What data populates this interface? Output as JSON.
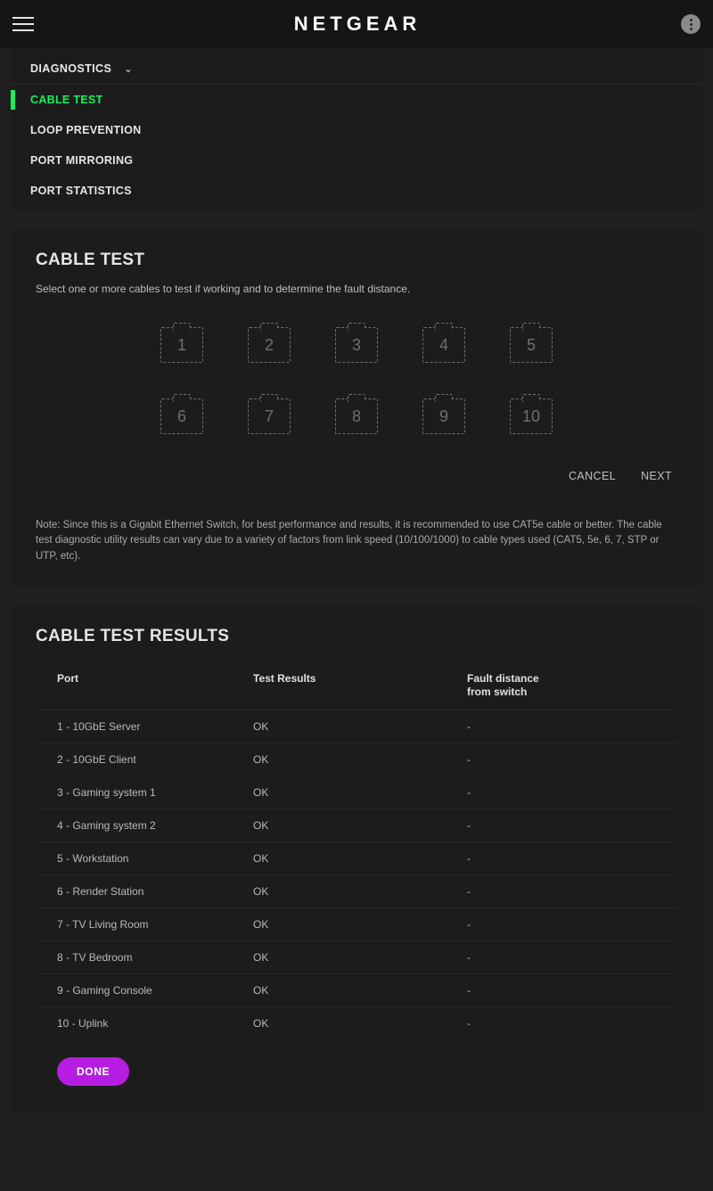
{
  "brand": "NETGEAR",
  "nav": {
    "section": "DIAGNOSTICS",
    "items": [
      {
        "label": "CABLE TEST",
        "active": true
      },
      {
        "label": "LOOP PREVENTION",
        "active": false
      },
      {
        "label": "PORT MIRRORING",
        "active": false
      },
      {
        "label": "PORT STATISTICS",
        "active": false
      }
    ]
  },
  "cable_test": {
    "title": "CABLE TEST",
    "help": "Select one or more cables to test if working and to determine the fault distance.",
    "ports": [
      "1",
      "2",
      "3",
      "4",
      "5",
      "6",
      "7",
      "8",
      "9",
      "10"
    ],
    "cancel": "CANCEL",
    "next": "NEXT",
    "note": "Note: Since this is a Gigabit Ethernet Switch, for best performance and results, it is recommended to use CAT5e cable or better. The cable test diagnostic utility results can vary due to a variety of factors from link speed (10/100/1000) to cable types used (CAT5, 5e, 6, 7, STP or UTP, etc)."
  },
  "results": {
    "title": "CABLE TEST RESULTS",
    "headers": {
      "port": "Port",
      "result": "Test Results",
      "fault": "Fault distance\nfrom switch"
    },
    "rows": [
      {
        "port": "1 - 10GbE Server",
        "result": "OK",
        "fault": "-"
      },
      {
        "port": "2 - 10GbE Client",
        "result": "OK",
        "fault": "-"
      },
      {
        "port": "3 - Gaming system 1",
        "result": "OK",
        "fault": "-"
      },
      {
        "port": "4 - Gaming system 2",
        "result": "OK",
        "fault": "-"
      },
      {
        "port": "5 - Workstation",
        "result": "OK",
        "fault": "-"
      },
      {
        "port": "6 - Render Station",
        "result": "OK",
        "fault": "-"
      },
      {
        "port": "7 - TV Living Room",
        "result": "OK",
        "fault": "-"
      },
      {
        "port": "8 - TV Bedroom",
        "result": "OK",
        "fault": "-"
      },
      {
        "port": "9 - Gaming Console",
        "result": "OK",
        "fault": "-"
      },
      {
        "port": "10 - Uplink",
        "result": "OK",
        "fault": "-"
      }
    ],
    "done": "DONE"
  }
}
